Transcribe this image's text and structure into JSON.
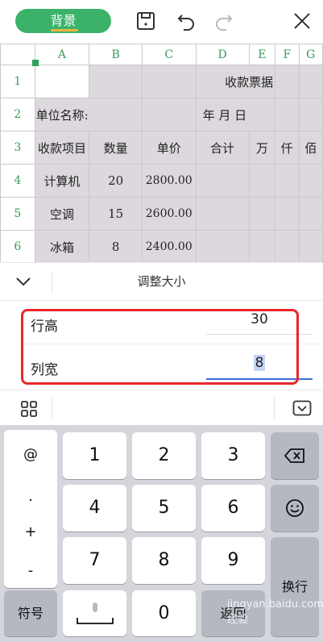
{
  "toolbar": {
    "background_label": "背景",
    "icons": [
      "save-icon",
      "undo-icon",
      "redo-icon",
      "close-icon"
    ]
  },
  "sheet": {
    "columns": [
      "A",
      "B",
      "C",
      "D",
      "E",
      "F",
      "G"
    ],
    "rows": [
      "1",
      "2",
      "3",
      "4",
      "5",
      "6"
    ],
    "cells": {
      "d1": "收款票据",
      "a2": "单位名称:",
      "d2": "年  月  日",
      "a3": "收款项目",
      "b3": "数量",
      "c3": "单价",
      "d3": "合计",
      "e3": "万",
      "f3": "仟",
      "g3": "佰",
      "a4": "计算机",
      "b4": "20",
      "c4": "2800.00",
      "a5": "空调",
      "b5": "15",
      "c5": "2600.00",
      "a6": "冰箱",
      "b6": "8",
      "c6": "2400.00"
    }
  },
  "panel": {
    "title": "调整大小",
    "row_height_label": "行高",
    "row_height_value": "30",
    "col_width_label": "列宽",
    "col_width_value": "8"
  },
  "keyboard": {
    "symbols": [
      "@",
      ".",
      "+",
      "-"
    ],
    "digits": [
      "1",
      "2",
      "3",
      "4",
      "5",
      "6",
      "7",
      "8",
      "9",
      "0"
    ],
    "symbol_key": "符号",
    "back_key": "返回",
    "enter_key": "换行"
  },
  "watermark": "jingyan.baidu.com 经验",
  "colors": {
    "accent_green": "#3ab26a",
    "highlight_red": "#e8272b",
    "input_blue": "#3d6fd6"
  }
}
